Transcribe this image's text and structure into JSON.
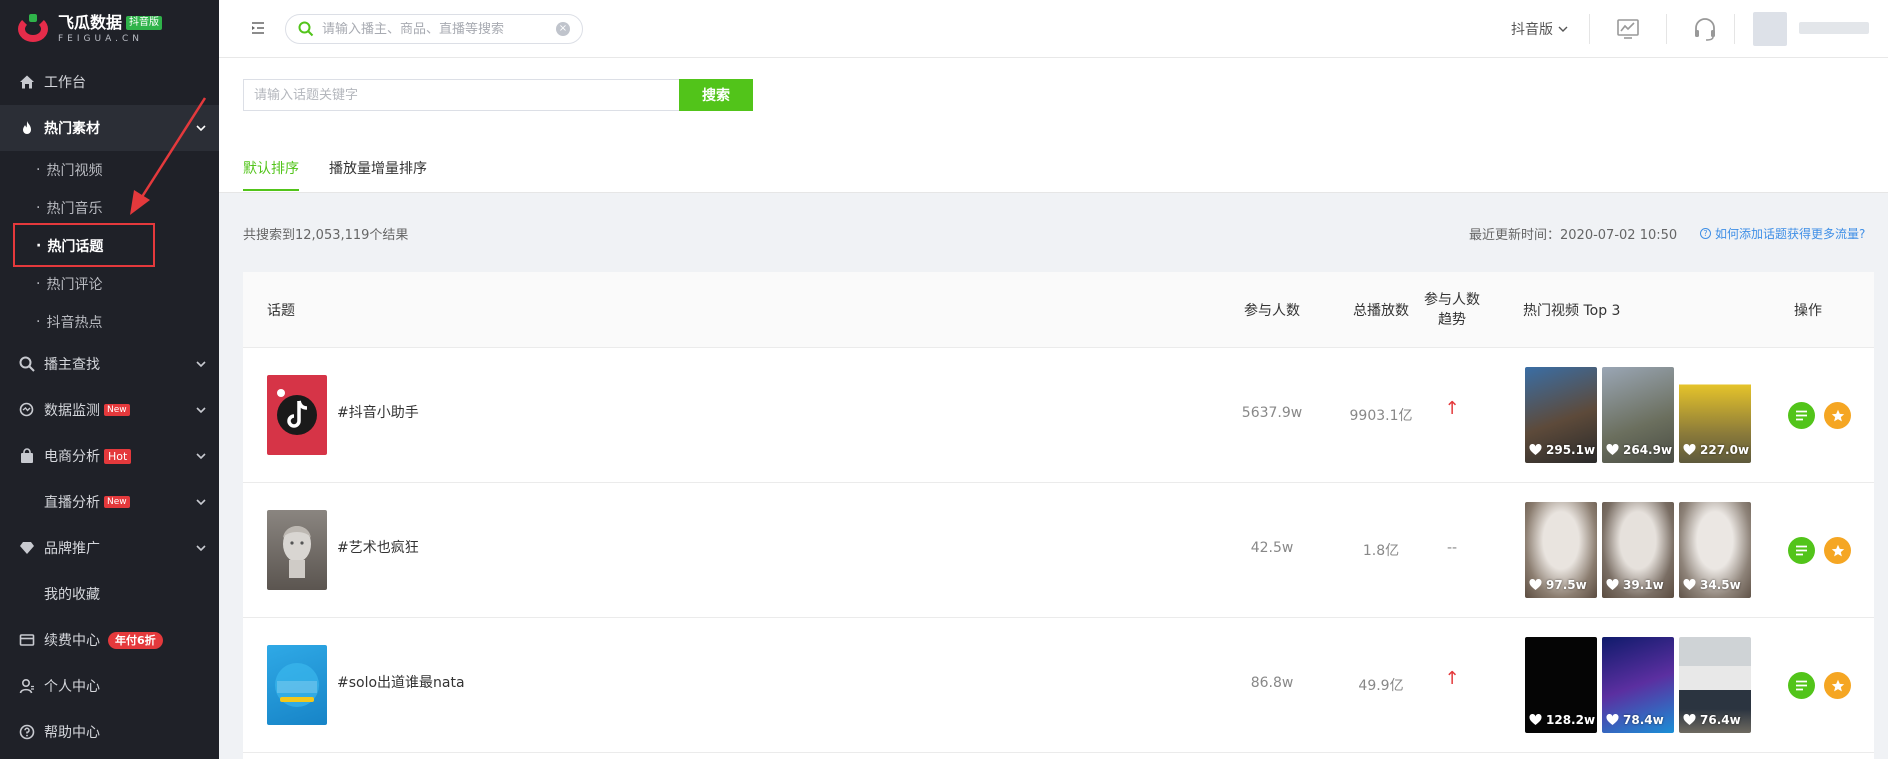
{
  "brand": {
    "title": "飞瓜数据",
    "badge": "抖音版",
    "sub": "FEIGUA.CN"
  },
  "sidebar": {
    "items": [
      {
        "label": "工作台",
        "icon": "home-icon"
      },
      {
        "label": "热门素材",
        "icon": "fire-icon",
        "expanded": true
      },
      {
        "label": "播主查找",
        "icon": "search-icon"
      },
      {
        "label": "数据监测",
        "icon": "monitor-icon",
        "badge": "New"
      },
      {
        "label": "电商分析",
        "icon": "shop-bag-icon",
        "badge": "Hot"
      },
      {
        "label": "直播分析",
        "badge": "New"
      },
      {
        "label": "品牌推广",
        "icon": "diamond-icon"
      },
      {
        "label": "我的收藏"
      },
      {
        "label": "续费中心",
        "icon": "card-icon",
        "badge": "年付6折"
      },
      {
        "label": "个人中心",
        "icon": "user-icon"
      },
      {
        "label": "帮助中心",
        "icon": "help-icon"
      }
    ],
    "sub_items": [
      {
        "label": "热门视频"
      },
      {
        "label": "热门音乐"
      },
      {
        "label": "热门话题",
        "active": true
      },
      {
        "label": "热门评论"
      },
      {
        "label": "抖音热点"
      }
    ],
    "bullet": "·"
  },
  "header": {
    "search_placeholder": "请输入播主、商品、直播等搜索",
    "clear_icon": "×",
    "edition": "抖音版"
  },
  "search": {
    "placeholder": "请输入话题关键字",
    "button": "搜索"
  },
  "tabs": [
    {
      "label": "默认排序",
      "active": true
    },
    {
      "label": "播放量增量排序"
    }
  ],
  "results": {
    "count_text": "共搜索到12,053,119个结果",
    "updated_label": "最近更新时间：",
    "updated_time": "2020-07-02 10:50",
    "help_link": "如何添加话题获得更多流量?",
    "help_icon": "?"
  },
  "table": {
    "headers": {
      "topic": "话题",
      "participants": "参与人数",
      "plays": "总播放数",
      "trend_line1": "参与人数",
      "trend_line2": "趋势",
      "top_videos": "热门视频 Top 3",
      "actions": "操作"
    },
    "rows": [
      {
        "topic": "#抖音小助手",
        "participants": "5637.9w",
        "plays": "9903.1亿",
        "trend": "↑",
        "videos": [
          {
            "likes": "295.1w"
          },
          {
            "likes": "264.9w"
          },
          {
            "likes": "227.0w"
          }
        ]
      },
      {
        "topic": "#艺术也疯狂",
        "participants": "42.5w",
        "plays": "1.8亿",
        "trend": "--",
        "videos": [
          {
            "likes": "97.5w"
          },
          {
            "likes": "39.1w"
          },
          {
            "likes": "34.5w"
          }
        ]
      },
      {
        "topic": "#solo出道谁最nata",
        "participants": "86.8w",
        "plays": "49.9亿",
        "trend": "↑",
        "videos": [
          {
            "likes": "128.2w"
          },
          {
            "likes": "78.4w"
          },
          {
            "likes": "76.4w"
          }
        ]
      }
    ]
  },
  "colors": {
    "accent": "#52c41a",
    "sidebar_bg": "#1f2128",
    "danger": "#e4393c",
    "link": "#3f8fe6",
    "star": "#f5a623"
  }
}
